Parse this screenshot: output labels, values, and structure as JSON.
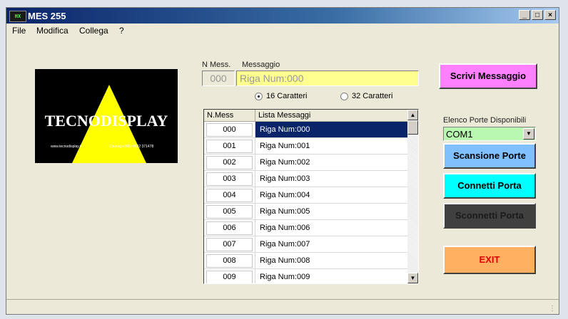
{
  "window": {
    "title": "MES 255",
    "icon_label": "HX",
    "minimize": "_",
    "maximize": "□",
    "close": "×"
  },
  "menu": [
    "File",
    "Modifica",
    "Collega",
    "?"
  ],
  "logo": {
    "brand": "TECNODISPLAY",
    "website": "www.tecnodisplay.it",
    "contact": "Cavriago (RE) 0522 371478"
  },
  "message": {
    "n_label": "N Mess.",
    "msg_label": "Messaggio",
    "n_value": "000",
    "msg_value": "Riga Num:000",
    "radio_16": "16 Caratteri",
    "radio_32": "32 Caratteri",
    "selected_radio": "16"
  },
  "list": {
    "col_n": "N.Mess",
    "col_msg": "Lista Messaggi",
    "rows": [
      {
        "n": "000",
        "msg": "Riga Num:000"
      },
      {
        "n": "001",
        "msg": "Riga Num:001"
      },
      {
        "n": "002",
        "msg": "Riga Num:002"
      },
      {
        "n": "003",
        "msg": "Riga Num:003"
      },
      {
        "n": "004",
        "msg": "Riga Num:004"
      },
      {
        "n": "005",
        "msg": "Riga Num:005"
      },
      {
        "n": "006",
        "msg": "Riga Num:006"
      },
      {
        "n": "007",
        "msg": "Riga Num:007"
      },
      {
        "n": "008",
        "msg": "Riga Num:008"
      },
      {
        "n": "009",
        "msg": "Riga Num:009"
      }
    ],
    "selected_index": 0
  },
  "buttons": {
    "write": "Scrivi Messaggio",
    "scan": "Scansione Porte",
    "connect": "Connetti Porta",
    "disconnect": "Sconnetti Porta",
    "exit": "EXIT"
  },
  "ports": {
    "label": "Elenco Porte Disponibili",
    "selected": "COM1"
  },
  "colors": {
    "write_bg": "#ff80ff",
    "scan_bg": "#80c0ff",
    "connect_bg": "#00ffff",
    "disconnect_bg": "#404040",
    "exit_bg": "#ffb060",
    "exit_fg": "#e00000",
    "msg_field_bg": "#ffff90",
    "combo_bg": "#b8f8b0",
    "logo_triangle": "#ffff00"
  }
}
